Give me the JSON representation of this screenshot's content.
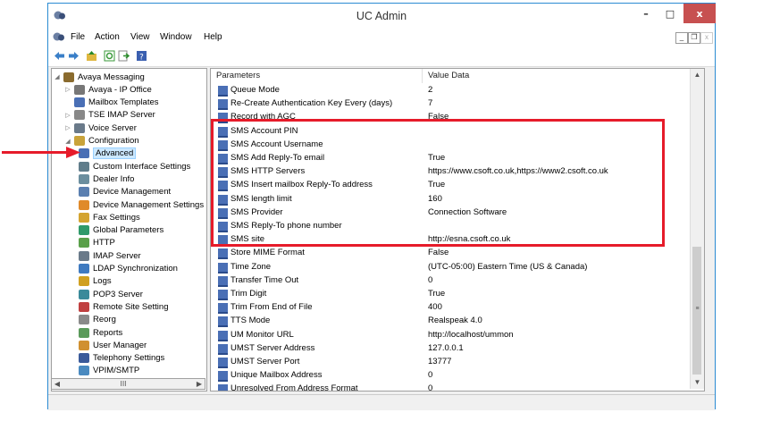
{
  "window": {
    "title": "UC Admin"
  },
  "window_controls": {
    "minimize": "–",
    "maximize": "□",
    "close": "x"
  },
  "menu": {
    "items": [
      "File",
      "Action",
      "View",
      "Window",
      "Help"
    ]
  },
  "mdi_controls": {
    "minimize": "_",
    "restore": "❐",
    "close": "x"
  },
  "tree": {
    "items": [
      {
        "label": "Avaya Messaging",
        "level": 0,
        "icon": "messaging-icon",
        "color": "#8a6b2e"
      },
      {
        "label": "Avaya - IP Office",
        "level": 1,
        "icon": "phone-icon",
        "color": "#777777"
      },
      {
        "label": "Mailbox Templates",
        "level": 1,
        "icon": "template-icon",
        "color": "#4a6fb5"
      },
      {
        "label": "TSE IMAP Server",
        "level": 1,
        "icon": "server-icon",
        "color": "#888888"
      },
      {
        "label": "Voice Server",
        "level": 1,
        "icon": "voice-server-icon",
        "color": "#6a7a8a"
      },
      {
        "label": "Configuration",
        "level": 1,
        "icon": "configuration-icon",
        "color": "#c9a33a"
      },
      {
        "label": "Advanced",
        "level": 2,
        "icon": "advanced-icon",
        "color": "#4a6fb5",
        "selected": true
      },
      {
        "label": "Custom Interface Settings",
        "level": 2,
        "icon": "interface-icon",
        "color": "#607d8b"
      },
      {
        "label": "Dealer Info",
        "level": 2,
        "icon": "dealer-icon",
        "color": "#6b8e9e"
      },
      {
        "label": "Device Management",
        "level": 2,
        "icon": "device-icon",
        "color": "#5a7fb0"
      },
      {
        "label": "Device Management Settings",
        "level": 2,
        "icon": "device-settings-icon",
        "color": "#e08a2a"
      },
      {
        "label": "Fax Settings",
        "level": 2,
        "icon": "fax-icon",
        "color": "#d4a430"
      },
      {
        "label": "Global Parameters",
        "level": 2,
        "icon": "globe-icon",
        "color": "#2f9a6a"
      },
      {
        "label": "HTTP",
        "level": 2,
        "icon": "http-icon",
        "color": "#5aa04a"
      },
      {
        "label": "IMAP Server",
        "level": 2,
        "icon": "imap-icon",
        "color": "#6a7a8a"
      },
      {
        "label": "LDAP Synchronization",
        "level": 2,
        "icon": "ldap-icon",
        "color": "#3f7ac0"
      },
      {
        "label": "Logs",
        "level": 2,
        "icon": "logs-icon",
        "color": "#d0a020"
      },
      {
        "label": "POP3 Server",
        "level": 2,
        "icon": "pop3-icon",
        "color": "#3a8a9a"
      },
      {
        "label": "Remote Site Setting",
        "level": 2,
        "icon": "remote-site-icon",
        "color": "#c04040"
      },
      {
        "label": "Reorg",
        "level": 2,
        "icon": "reorg-icon",
        "color": "#8a8a8a"
      },
      {
        "label": "Reports",
        "level": 2,
        "icon": "reports-icon",
        "color": "#5a9a5a"
      },
      {
        "label": "User Manager",
        "level": 2,
        "icon": "user-icon",
        "color": "#d09030"
      },
      {
        "label": "Telephony Settings",
        "level": 2,
        "icon": "telephony-icon",
        "color": "#3a5a9a"
      },
      {
        "label": "VPIM/SMTP",
        "level": 2,
        "icon": "vpim-icon",
        "color": "#4a8ac0"
      }
    ]
  },
  "tree_scrollbar": {
    "thumb_label": "III"
  },
  "columns": [
    "Parameters",
    "Value Data"
  ],
  "rows": [
    {
      "name": "Queue Mode",
      "value": "2"
    },
    {
      "name": "Re-Create Authentication Key Every (days)",
      "value": "7"
    },
    {
      "name": "Record with AGC",
      "value": "False"
    },
    {
      "name": "SMS Account PIN",
      "value": ""
    },
    {
      "name": "SMS Account Username",
      "value": ""
    },
    {
      "name": "SMS Add Reply-To email",
      "value": "True"
    },
    {
      "name": "SMS HTTP Servers",
      "value": "https://www.csoft.co.uk,https://www2.csoft.co.uk"
    },
    {
      "name": "SMS Insert mailbox Reply-To address",
      "value": "True"
    },
    {
      "name": "SMS length limit",
      "value": "160"
    },
    {
      "name": "SMS Provider",
      "value": "Connection Software"
    },
    {
      "name": "SMS Reply-To phone number",
      "value": ""
    },
    {
      "name": "SMS site",
      "value": "http://esna.csoft.co.uk"
    },
    {
      "name": "Store MIME Format",
      "value": "False"
    },
    {
      "name": "Time Zone",
      "value": "(UTC-05:00) Eastern Time (US & Canada)"
    },
    {
      "name": "Transfer Time Out",
      "value": "0"
    },
    {
      "name": "Trim Digit",
      "value": "True"
    },
    {
      "name": "Trim From End of File",
      "value": "400"
    },
    {
      "name": "TTS Mode",
      "value": "Realspeak 4.0"
    },
    {
      "name": "UM Monitor URL",
      "value": "http://localhost/ummon"
    },
    {
      "name": "UMST Server Address",
      "value": "127.0.0.1"
    },
    {
      "name": "UMST Server Port",
      "value": "13777"
    },
    {
      "name": "Unique Mailbox Address",
      "value": "0"
    },
    {
      "name": "Unresolved From Address Format",
      "value": "0"
    }
  ],
  "annotations": {
    "highlight_color": "#e61b2a",
    "arrow_color": "#e61b2a"
  }
}
